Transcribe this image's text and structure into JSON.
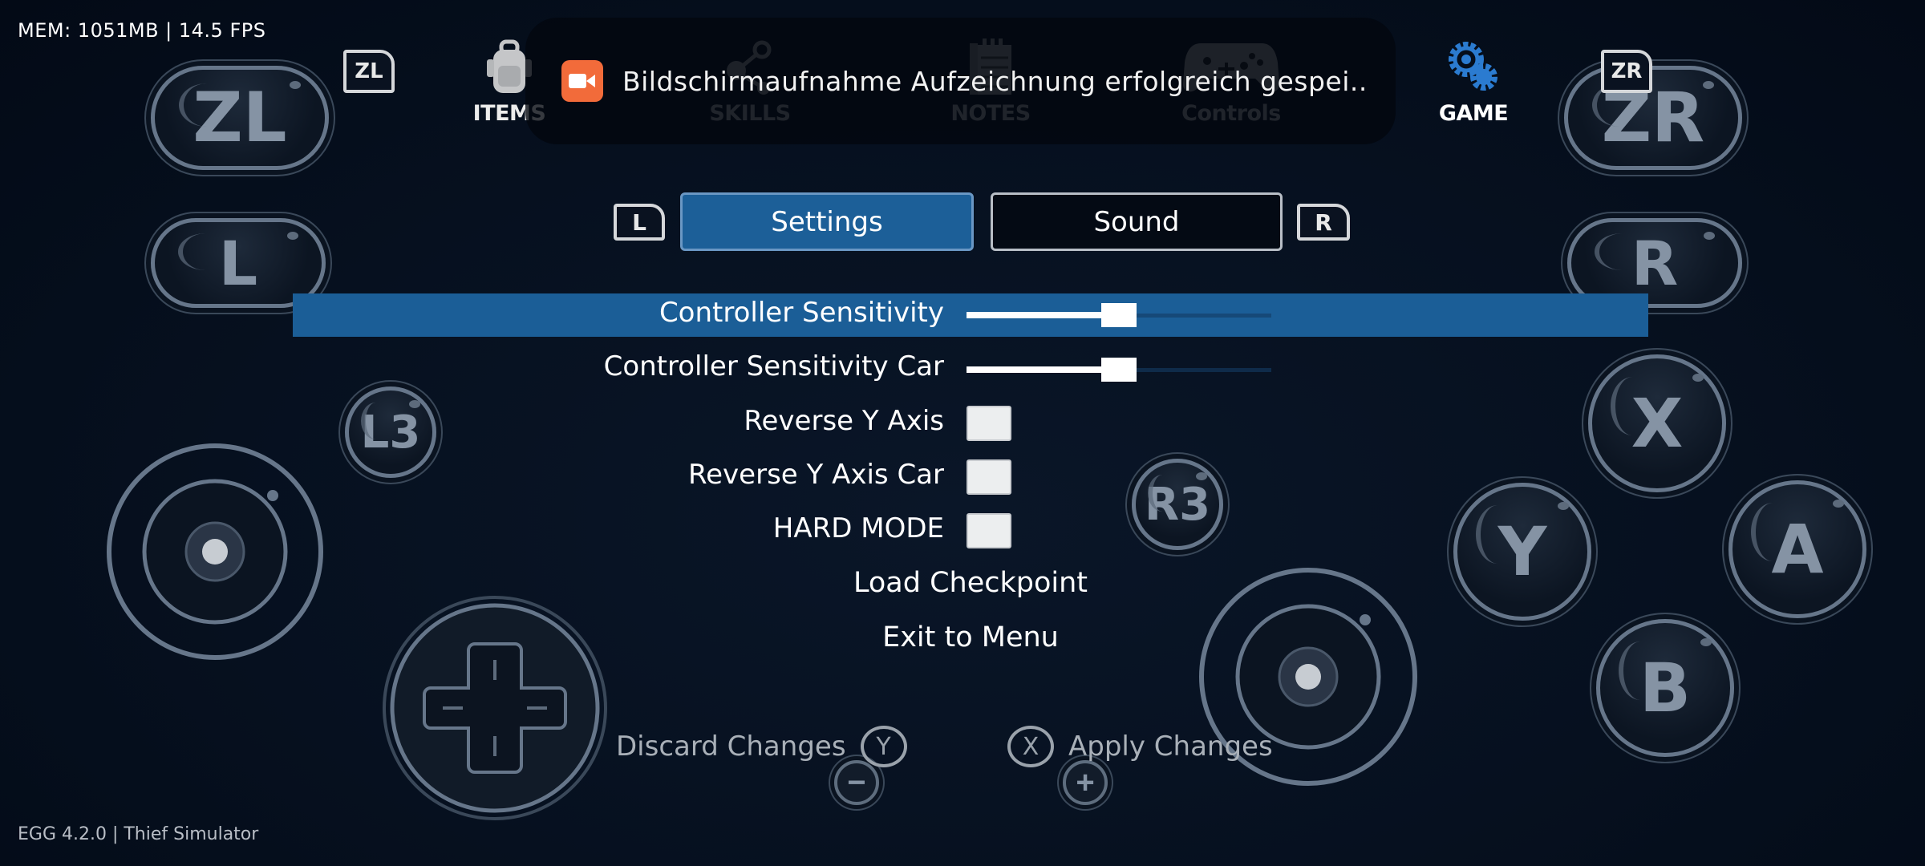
{
  "hud": {
    "stats": "MEM:  1051MB | 14.5 FPS"
  },
  "footer": {
    "version": "EGG 4.2.0 | Thief Simulator"
  },
  "nav": {
    "items": [
      {
        "label": "ITEMS",
        "icon": "backpack-icon"
      },
      {
        "label": "SKILLS",
        "icon": "skill-tree-icon"
      },
      {
        "label": "NOTES",
        "icon": "notepad-icon"
      },
      {
        "label": "Controls",
        "icon": "gamepad-icon"
      },
      {
        "label": "GAME",
        "icon": "gears-icon",
        "active": true
      }
    ],
    "left_bumper_badge": "ZL",
    "right_bumper_badge": "ZR"
  },
  "toast": {
    "icon": "screen-record-icon",
    "text": "Bildschirmaufnahme  Aufzeichnung erfolgreich gespei.."
  },
  "tabs": {
    "prev_badge": "L",
    "next_badge": "R",
    "items": [
      {
        "label": "Settings",
        "active": true
      },
      {
        "label": "Sound",
        "active": false
      }
    ]
  },
  "settings": {
    "rows": [
      {
        "label": "Controller Sensitivity",
        "type": "slider",
        "value": 0.5,
        "selected": true
      },
      {
        "label": "Controller Sensitivity Car",
        "type": "slider",
        "value": 0.5
      },
      {
        "label": "Reverse Y Axis",
        "type": "checkbox",
        "checked": false
      },
      {
        "label": "Reverse Y Axis Car",
        "type": "checkbox",
        "checked": false
      },
      {
        "label": "HARD MODE",
        "type": "checkbox",
        "checked": false
      }
    ],
    "actions": [
      {
        "label": "Load Checkpoint"
      },
      {
        "label": "Exit to Menu"
      }
    ]
  },
  "footer_actions": {
    "discard": {
      "label": "Discard Changes",
      "glyph": "Y"
    },
    "apply": {
      "label": "Apply Changes",
      "glyph": "X"
    }
  },
  "virtual_controller": {
    "zl": "ZL",
    "zr": "ZR",
    "l": "L",
    "r": "R",
    "l3": "L3",
    "r3": "R3",
    "x": "X",
    "y": "Y",
    "a": "A",
    "b": "B",
    "minus": "−",
    "plus": "+"
  },
  "colors": {
    "accent": "#1b5e97",
    "toast_icon": "#f26b3a",
    "active_nav_icon": "#2b7bd0"
  }
}
